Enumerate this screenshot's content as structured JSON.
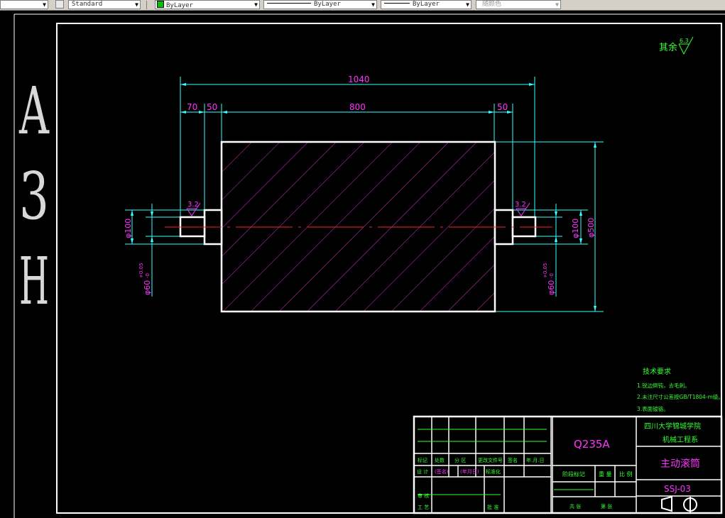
{
  "toolbar": {
    "style": "Standard",
    "layer": "ByLayer",
    "linetype": "ByLayer",
    "lineweight": "ByLayer",
    "color": "随颜色"
  },
  "drawing": {
    "sheet_size": "A3H",
    "sheet_letters": [
      "A",
      "3",
      "H"
    ],
    "surface_roughness_note": "其余",
    "roughness_general": "6.3",
    "roughness_shaft": "3.2",
    "dimensions": {
      "total_length": "1040",
      "shaft_length": "70",
      "shoulder_length": "50",
      "drum_length": "800",
      "drum_diameter": "φ500",
      "shoulder_diameter": "φ100",
      "shaft_diameter": "φ60",
      "shaft_tol": "+0.05",
      "shaft_tol_low": "-0"
    },
    "tech_requirements": {
      "title": "技术要求",
      "items": [
        "1.锐边倒钝，去毛刺。",
        "2.未注尺寸公差按GB/T1804-m级。",
        "3.表面镀铬。"
      ]
    },
    "title_block": {
      "material": "Q235A",
      "school": "四川大学锦城学院",
      "department": "机械工程系",
      "part_name": "主动滚筒",
      "drawing_no": "SSJ-03",
      "labels": {
        "mark": "标记",
        "count": "处数",
        "zone": "分 区",
        "change_doc": "更改文件号",
        "sign": "签名",
        "date": "年.月.日",
        "design": "设 计",
        "sign_paren": "(签名)",
        "date_paren": "(年月日)",
        "standardize": "标准化",
        "stage_mark": "阶段标记",
        "weight": "重 量",
        "scale": "比 例",
        "review": "审 核",
        "process": "工 艺",
        "approve": "批 准",
        "total_sheets": "共  张",
        "sheet_no": "第  张"
      }
    }
  }
}
